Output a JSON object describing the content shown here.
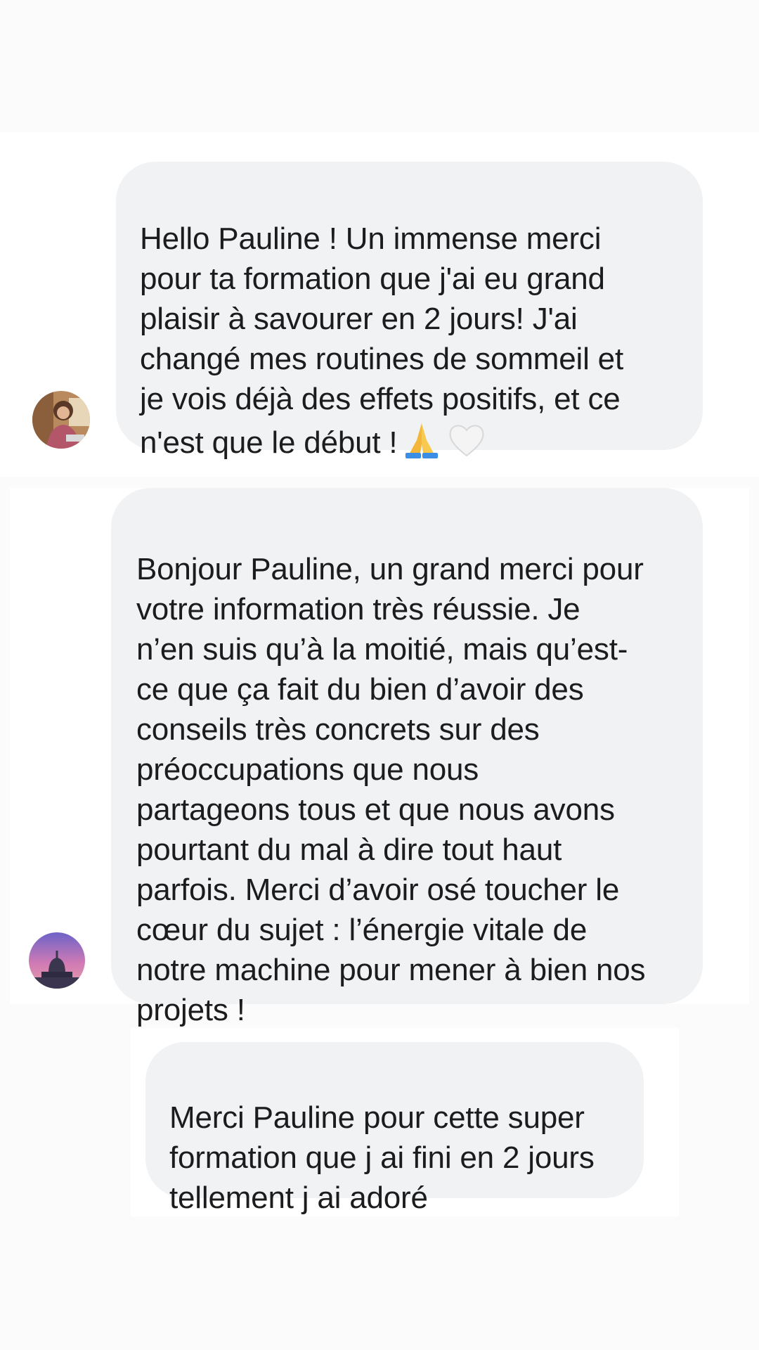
{
  "messages": [
    {
      "sender": "avatar-woman-indoor",
      "text": "Hello Pauline ! Un immense merci\npour ta formation que j'ai eu grand\nplaisir à savourer en 2 jours! J'ai\nchangé mes routines de sommeil et\nje vois déjà des effets positifs, et ce\nn'est que le début !",
      "trailing_emojis": [
        "folded-hands-emoji",
        "white-heart-emoji"
      ]
    },
    {
      "sender": "avatar-dome-sunset",
      "text": "Bonjour Pauline, un grand merci pour\nvotre information très réussie. Je\nn’en suis qu’à la moitié, mais qu’est-\nce que ça fait du bien d’avoir des\nconseils très concrets sur des\npréoccupations que nous\npartageons tous et que nous avons\npourtant du mal à dire tout haut\nparfois. Merci d’avoir osé toucher le\ncœur du sujet : l’énergie vitale de\nnotre machine pour mener à bien nos\nprojets !"
    },
    {
      "text": "Merci Pauline pour cette super\nformation que j ai fini en 2 jours\ntellement j ai adoré"
    }
  ],
  "colors": {
    "page_background": "#fbfbfb",
    "panel_background": "#ffffff",
    "bubble_background": "#f1f2f4",
    "text": "#1c1c1e"
  }
}
